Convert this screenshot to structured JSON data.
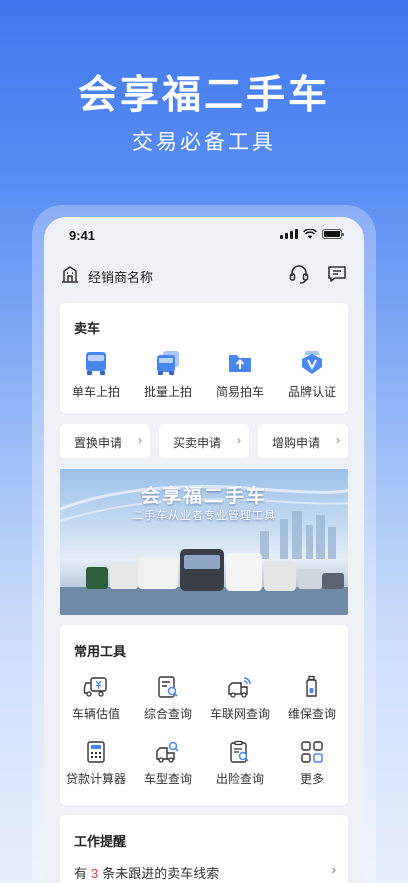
{
  "hero": {
    "title": "会享福二手车",
    "subtitle": "交易必备工具"
  },
  "status_bar": {
    "time": "9:41"
  },
  "header": {
    "dealer_name": "经销商名称",
    "icons": [
      "building-icon",
      "headset-icon",
      "message-icon"
    ]
  },
  "sell_car": {
    "title": "卖车",
    "items": [
      {
        "label": "单车上拍",
        "icon": "truck-icon"
      },
      {
        "label": "批量上拍",
        "icon": "trucks-icon"
      },
      {
        "label": "简易拍车",
        "icon": "folder-upload-icon"
      },
      {
        "label": "品牌认证",
        "icon": "badge-v-icon"
      }
    ]
  },
  "quick_links": [
    {
      "label": "置换申请"
    },
    {
      "label": "买卖申请"
    },
    {
      "label": "增购申请"
    }
  ],
  "banner": {
    "title": "会享福二手车",
    "subtitle": "二手车从业者专业管理工具"
  },
  "tools": {
    "title": "常用工具",
    "items": [
      {
        "label": "车辆估值",
        "icon": "truck-yen-icon"
      },
      {
        "label": "综合查询",
        "icon": "doc-search-icon"
      },
      {
        "label": "车联网查询",
        "icon": "truck-signal-icon"
      },
      {
        "label": "维保查询",
        "icon": "bottle-icon"
      },
      {
        "label": "贷款计算器",
        "icon": "calculator-icon"
      },
      {
        "label": "车型查询",
        "icon": "truck-search-icon"
      },
      {
        "label": "出险查询",
        "icon": "clipboard-search-icon"
      },
      {
        "label": "更多",
        "icon": "grid-more-icon"
      }
    ]
  },
  "reminders": {
    "title": "工作提醒",
    "row_prefix": "有",
    "row_count": "3",
    "row_suffix": "条未跟进的卖车线索"
  },
  "colors": {
    "accent": "#3f77ee",
    "icon_blue": "#4a86f0",
    "highlight_red": "#e23b3b"
  }
}
